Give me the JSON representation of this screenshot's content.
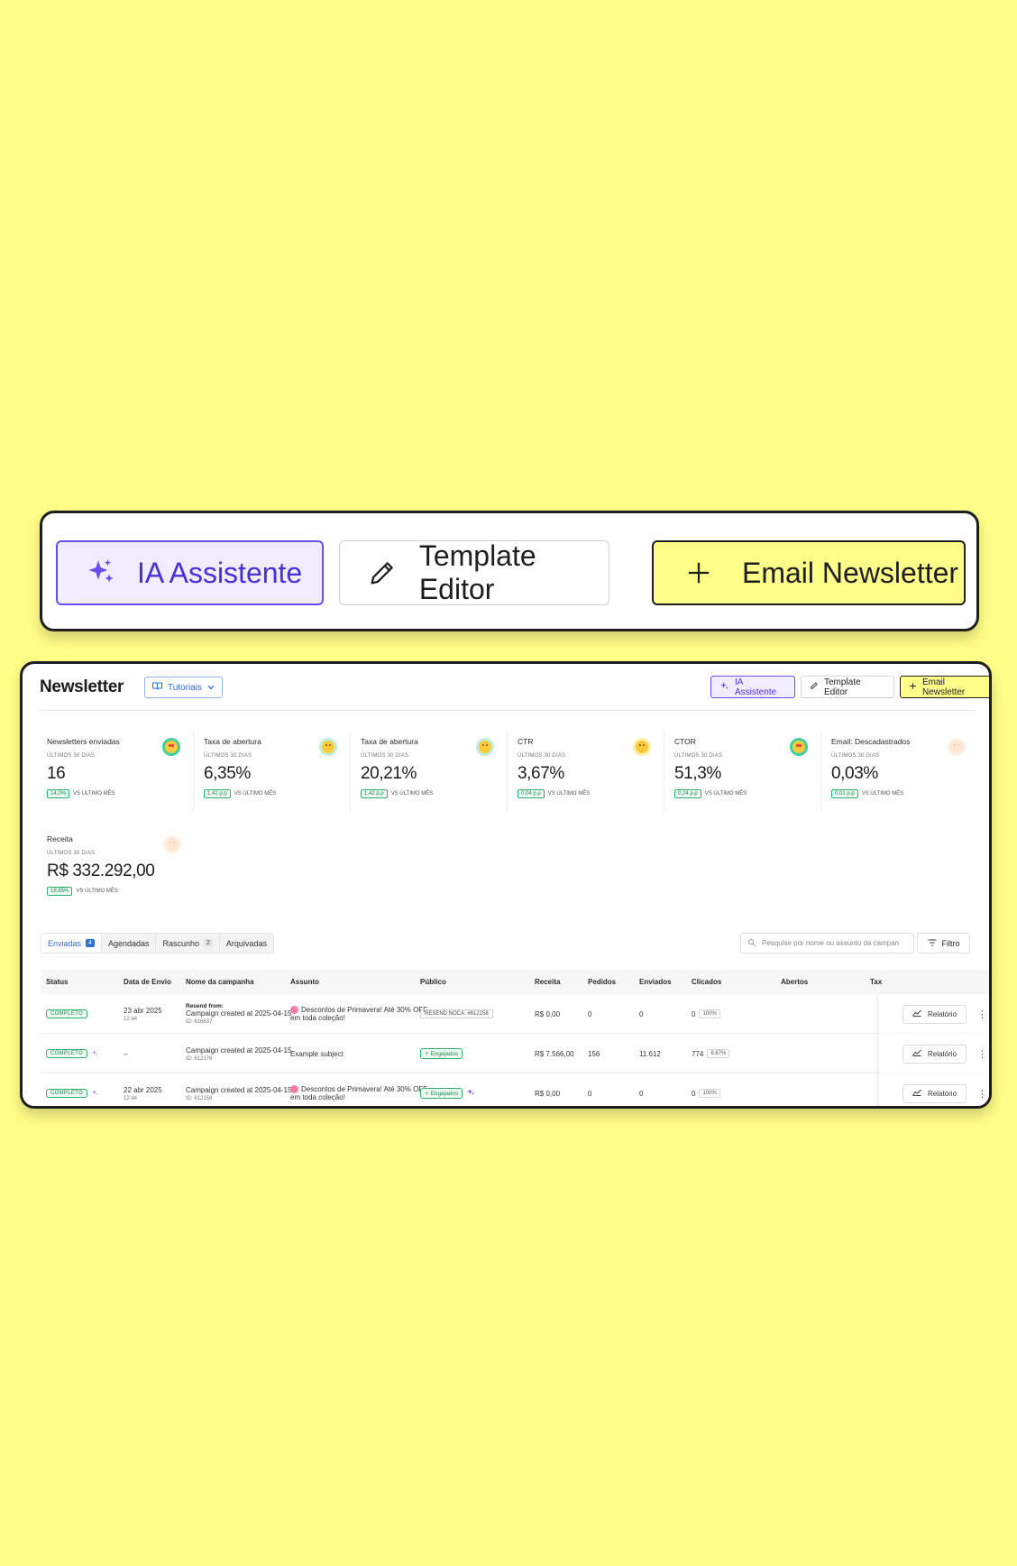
{
  "toolbar": {
    "ai_label": "IA Assistente",
    "template_label": "Template Editor",
    "new_label": "Email Newsletter"
  },
  "header": {
    "title": "Newsletter",
    "tutorials": "Tutoriais"
  },
  "metrics": [
    {
      "label": "Newsletters enviadas",
      "period": "ÚLTIMOS 30 DIAS",
      "value": "16",
      "delta": "14,0%",
      "compare": "VS ÚLTIMO MÊS",
      "mood": "good"
    },
    {
      "label": "Taxa de abertura",
      "period": "ÚLTIMOS 30 DIAS",
      "value": "6,35%",
      "delta": "1,42 p.p",
      "compare": "VS ÚLTIMO MÊS",
      "mood": "ok"
    },
    {
      "label": "Taxa de abertura",
      "period": "ÚLTIMOS 30 DIAS",
      "value": "20,21%",
      "delta": "1,42 p.p",
      "compare": "VS ÚLTIMO MÊS",
      "mood": "ok"
    },
    {
      "label": "CTR",
      "period": "ÚLTIMOS 30 DIAS",
      "value": "3,67%",
      "delta": "0,04 p.p",
      "compare": "VS ÚLTIMO MÊS",
      "mood": "meh"
    },
    {
      "label": "CTOR",
      "period": "ÚLTIMOS 30 DIAS",
      "value": "51,3%",
      "delta": "0,24 p.p",
      "compare": "VS ÚLTIMO MÊS",
      "mood": "good"
    },
    {
      "label": "Email: Descadastrados",
      "period": "ÚLTIMOS 30 DIAS",
      "value": "0,03%",
      "delta": "0,01 p.p",
      "compare": "VS ÚLTIMO MÊS",
      "mood": "none"
    },
    {
      "label": "Receita",
      "period": "ÚLTIMOS 30 DIAS",
      "value": "R$ 332.292,00",
      "delta": "18,85%",
      "compare": "VS ÚLTIMO MÊS",
      "mood": "none"
    }
  ],
  "tabs": [
    {
      "label": "Enviadas",
      "count": "4"
    },
    {
      "label": "Agendadas",
      "count": ""
    },
    {
      "label": "Rascunho",
      "count": "2"
    },
    {
      "label": "Arquivadas",
      "count": ""
    }
  ],
  "search": {
    "placeholder": "Pesquise por nome ou assunto da campan"
  },
  "filter_label": "Filtro",
  "table": {
    "columns": [
      "Status",
      "Data de Envio",
      "Nome da campanha",
      "Assunto",
      "Público",
      "Receita",
      "Pedidos",
      "Enviados",
      "Clicados",
      "Abertos",
      "Tax"
    ],
    "rows": [
      {
        "status": "COMPLETO",
        "ai": false,
        "date": "23 abr 2025",
        "time": "12:44",
        "resend": "Resend from:",
        "name": "Campaign created at 2025-04-15",
        "id": "ID: 616637",
        "subject_line1": "Descontos de Primavera! Até 30% OFF",
        "subject_line2": "em toda coleção!",
        "subject_flower": true,
        "audience": "RESEND NOCA: #612158",
        "audience_type": "tag",
        "revenue": "R$ 0,00",
        "orders": "0",
        "sent": "0",
        "clicks": "0",
        "clicks_pct": "100%",
        "report": "Relatório"
      },
      {
        "status": "COMPLETO",
        "ai": true,
        "date": "–",
        "time": "",
        "resend": "",
        "name": "Campaign created at 2025-04-15",
        "id": "ID: 612176",
        "subject_line1": "Example subject",
        "subject_line2": "",
        "subject_flower": false,
        "audience": "Engajados",
        "audience_type": "eng",
        "revenue": "R$ 7.566,00",
        "orders": "156",
        "sent": "11.612",
        "clicks": "774",
        "clicks_pct": "6.67%",
        "report": "Relatório"
      },
      {
        "status": "COMPLETO",
        "ai": true,
        "date": "22 abr 2025",
        "time": "12:44",
        "resend": "",
        "name": "Campaign created at 2025-04-15",
        "id": "ID: 612158",
        "subject_line1": "Descontos de Primavera! Até 30% OFF",
        "subject_line2": "em toda coleção!",
        "subject_flower": true,
        "audience": "Engajados",
        "audience_type": "eng",
        "revenue": "R$ 0,00",
        "orders": "0",
        "sent": "0",
        "clicks": "0",
        "clicks_pct": "100%",
        "report": "Relatório"
      }
    ]
  },
  "colors": {
    "background": "#fffe88",
    "ai_accent": "#6a4cf0",
    "link_blue": "#2e6fd8",
    "success_green": "#1a8a4b"
  },
  "icons": {
    "ai": "sparkles-icon",
    "template": "pencil-icon",
    "new": "plus-icon",
    "tutorials": "book-icon",
    "search": "search-icon",
    "filter": "filter-icon",
    "report": "chart-icon",
    "more": "more-vertical-icon"
  }
}
